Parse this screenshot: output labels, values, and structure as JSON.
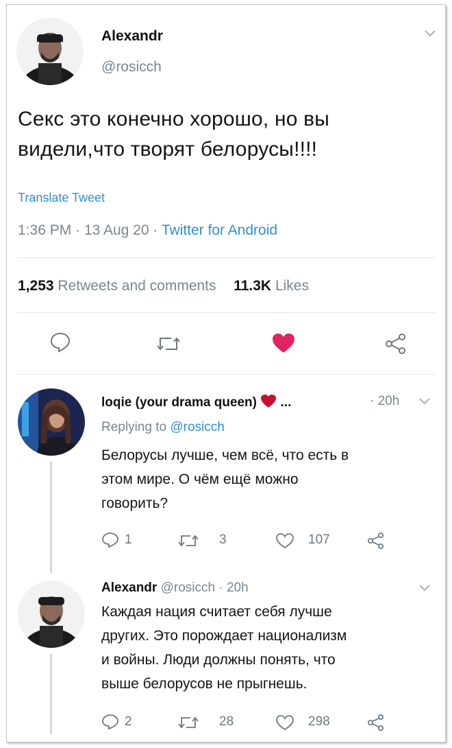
{
  "main_tweet": {
    "display_name": "Alexandr",
    "handle": "@rosicch",
    "text_line1": "Секс это конечно хорошо, но вы",
    "text_line2": "видели,что творят белорусы!!!!",
    "translate_label": "Translate Tweet",
    "time": "1:36 PM",
    "sep1": "·",
    "date": "13 Aug 20",
    "sep2": "·",
    "source": "Twitter for Android",
    "retweets_count": "1,253",
    "retweets_label": "Retweets and comments",
    "likes_count": "11.3K",
    "likes_label": "Likes"
  },
  "reply1": {
    "display_name": "loqie (your drama queen)",
    "ellipsis": "...",
    "time": "· 20h",
    "replying_prefix": "Replying to",
    "replying_handle": "@rosicch",
    "text_line1": "Белорусы лучше, чем всё, что есть в",
    "text_line2": "этом мире. О чём ещё можно",
    "text_line3": "говорить?",
    "replies": "1",
    "retweets": "3",
    "likes": "107"
  },
  "reply2": {
    "display_name": "Alexandr",
    "handle_time": "@rosicch · 20h",
    "text_line1": "Каждая нация считает себя лучше",
    "text_line2": "других. Это порождает национализм",
    "text_line3": "и войны. Люди должны понять, что",
    "text_line4": "выше белорусов не прыгнешь.",
    "replies": "2",
    "retweets": "28",
    "likes": "298"
  },
  "colors": {
    "link_blue": "#2e8fd8",
    "like_red": "#e0245e",
    "grey_text": "#7a8590"
  }
}
